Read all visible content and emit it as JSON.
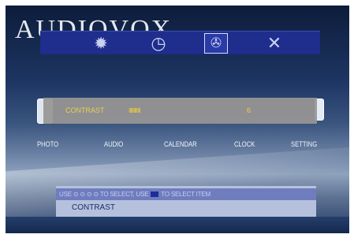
{
  "brand": {
    "text": "AUDIOVOX"
  },
  "menu": {
    "icons": [
      "gear-icon",
      "clock-icon",
      "film-reel-icon",
      "close-icon"
    ],
    "selected": "film-reel-icon"
  },
  "modes": [
    "PHOTO",
    "AUDIO",
    "CALENDAR",
    "CLOCK",
    "SETTING"
  ],
  "adjustment": {
    "label": "CONTRAST",
    "level_text": "IIIIIIIIIIII",
    "value": "6"
  },
  "help": {
    "hint_prefix": "USE ⊙ ⊙ ⊙ ⊙ TO SELECT, USE",
    "hint_suffix": "TO SELECT ITEM",
    "current_item": "CONTRAST"
  },
  "colors": {
    "menu_bar": "#1f2d8c",
    "highlight_text": "#e9cf4f",
    "hint_bar": "#6f7dbf",
    "help_panel": "#b5c1dc"
  }
}
